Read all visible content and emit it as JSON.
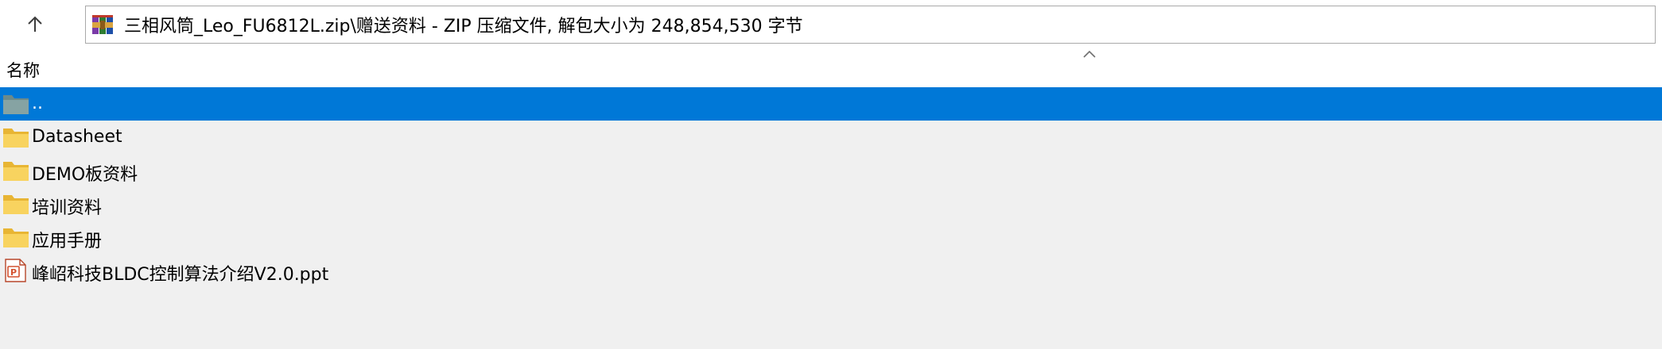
{
  "toolbar": {
    "up_icon": "arrow-up-icon",
    "address_icon": "winrar-archive-icon",
    "address_text": "三相风筒_Leo_FU6812L.zip\\赠送资料 - ZIP 压缩文件, 解包大小为 248,854,530 字节"
  },
  "list_header": {
    "name_label": "名称",
    "sort_icon": "sort-ascending-icon"
  },
  "files": [
    {
      "label": "..",
      "icon": "parent-folder-icon",
      "selected": true
    },
    {
      "label": "Datasheet",
      "icon": "folder-icon",
      "selected": false
    },
    {
      "label": "DEMO板资料",
      "icon": "folder-icon",
      "selected": false
    },
    {
      "label": "培训资料",
      "icon": "folder-icon",
      "selected": false
    },
    {
      "label": "应用手册",
      "icon": "folder-icon",
      "selected": false
    },
    {
      "label": "峰岹科技BLDC控制算法介绍V2.0.ppt",
      "icon": "powerpoint-file-icon",
      "selected": false
    }
  ],
  "colors": {
    "selection": "#0078d7",
    "folder": "#f8d35f",
    "folder_dark": "#e8b534"
  }
}
